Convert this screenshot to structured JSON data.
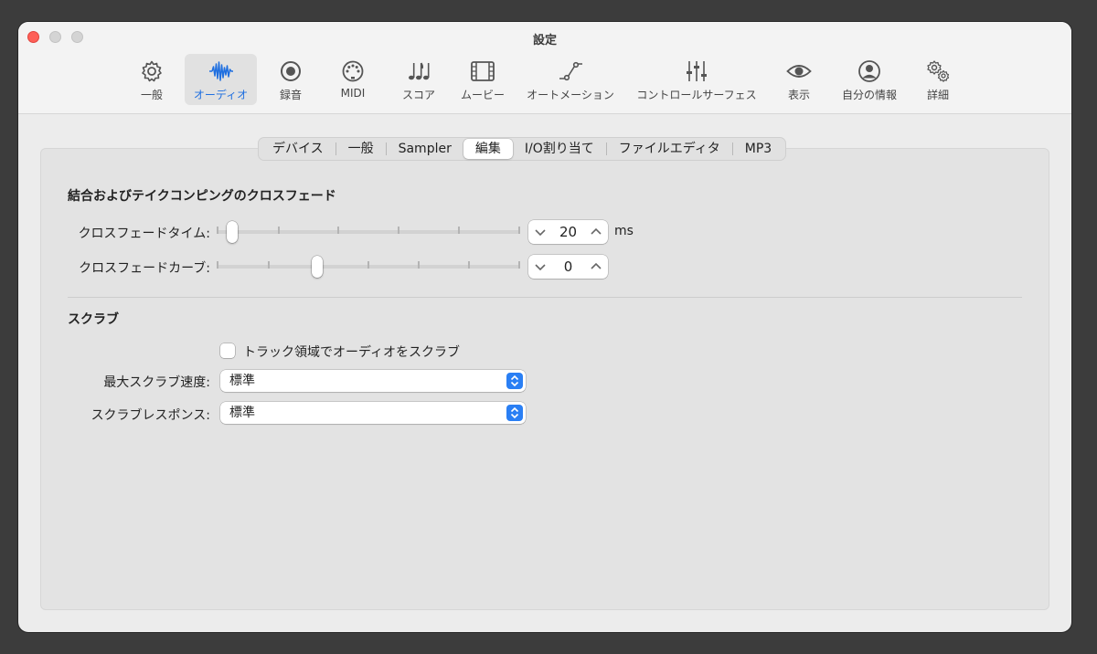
{
  "window": {
    "title": "設定"
  },
  "toolbar": {
    "items": [
      {
        "label": "一般",
        "icon": "gear-icon",
        "active": false
      },
      {
        "label": "オーディオ",
        "icon": "waveform-icon",
        "active": true
      },
      {
        "label": "録音",
        "icon": "record-icon",
        "active": false
      },
      {
        "label": "MIDI",
        "icon": "midi-connector-icon",
        "active": false
      },
      {
        "label": "スコア",
        "icon": "music-notes-icon",
        "active": false
      },
      {
        "label": "ムービー",
        "icon": "film-icon",
        "active": false
      },
      {
        "label": "オートメーション",
        "icon": "automation-curve-icon",
        "active": false
      },
      {
        "label": "コントロールサーフェス",
        "icon": "sliders-icon",
        "active": false
      },
      {
        "label": "表示",
        "icon": "eye-icon",
        "active": false
      },
      {
        "label": "自分の情報",
        "icon": "person-circle-icon",
        "active": false
      },
      {
        "label": "詳細",
        "icon": "gears-icon",
        "active": false
      }
    ],
    "accent_color": "#1f6fe0"
  },
  "tabs": [
    {
      "label": "デバイス",
      "selected": false
    },
    {
      "label": "一般",
      "selected": false
    },
    {
      "label": "Sampler",
      "selected": false
    },
    {
      "label": "編集",
      "selected": true
    },
    {
      "label": "I/O割り当て",
      "selected": false
    },
    {
      "label": "ファイルエディタ",
      "selected": false
    },
    {
      "label": "MP3",
      "selected": false
    }
  ],
  "crossfade": {
    "title": "結合およびテイクコンピングのクロスフェード",
    "time": {
      "label": "クロスフェードタイム:",
      "value": "20",
      "unit": "ms",
      "slider_fraction": 0.05
    },
    "curve": {
      "label": "クロスフェードカーブ:",
      "value": "0",
      "slider_fraction": 0.33
    }
  },
  "scrub": {
    "title": "スクラブ",
    "checkbox": {
      "label": "トラック領域でオーディオをスクラブ",
      "checked": false
    },
    "max_speed": {
      "label": "最大スクラブ速度:",
      "value": "標準"
    },
    "response": {
      "label": "スクラブレスポンス:",
      "value": "標準"
    }
  }
}
